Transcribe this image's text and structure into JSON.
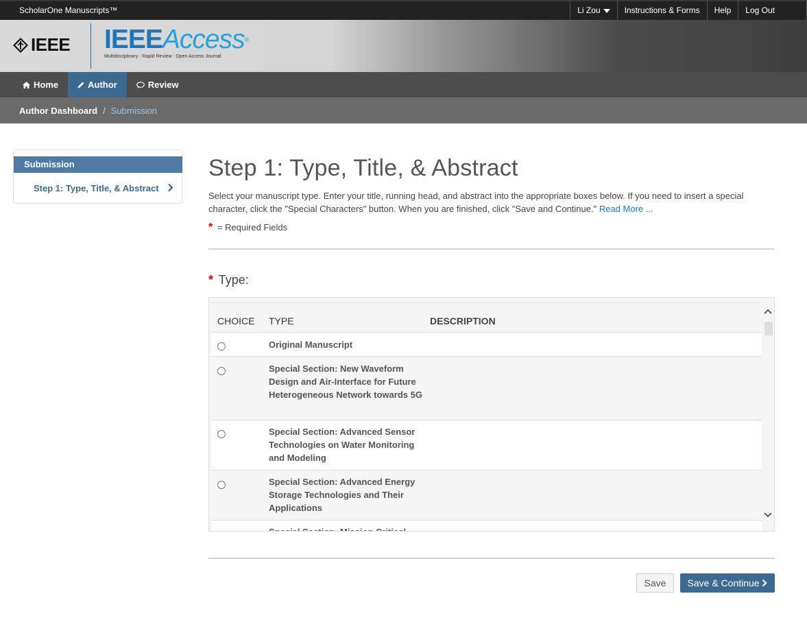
{
  "topbar": {
    "brand": "ScholarOne Manuscripts™",
    "user_menu": "Li Zou",
    "instructions": "Instructions & Forms",
    "help": "Help",
    "logout": "Log Out"
  },
  "header": {
    "ieee_logo_text": "IEEE",
    "access_logo_bold": "IEEE",
    "access_logo_thin": "Access",
    "access_tagline": [
      "Multidisciplinary",
      "Rapid Review",
      "Open Access Journal"
    ]
  },
  "mainnav": {
    "tabs": [
      {
        "label": "Home",
        "icon": "home-icon",
        "active": false
      },
      {
        "label": "Author",
        "icon": "pencil-icon",
        "active": true
      },
      {
        "label": "Review",
        "icon": "comment-icon",
        "active": false
      }
    ]
  },
  "breadcrumb": {
    "root": "Author Dashboard",
    "separator": "/",
    "current": "Submission"
  },
  "sidebar": {
    "heading": "Submission",
    "items": [
      {
        "label": "Step 1: Type, Title, & Abstract"
      }
    ]
  },
  "main": {
    "title": "Step 1: Type, Title, & Abstract",
    "intro": "Select your manuscript type. Enter your title, running head, and abstract into the appropriate boxes below. If you need to insert a special character, click the \"Special Characters\" button. When you are finished, click \"Save and Continue.\"",
    "read_more": "Read More ...",
    "required_marker": "*",
    "required_note": "= Required Fields",
    "type_label": "Type:",
    "table": {
      "columns": [
        "CHOICE",
        "TYPE",
        "DESCRIPTION"
      ],
      "rows": [
        {
          "type": "Original Manuscript",
          "description": ""
        },
        {
          "type": "Special Section: New Waveform Design and Air-Interface for Future Heterogeneous Network towards 5G",
          "description": ""
        },
        {
          "type": "Special Section: Advanced Sensor Technologies on Water Monitoring and Modeling",
          "description": ""
        },
        {
          "type": "Special Section: Advanced Energy Storage Technologies and Their Applications",
          "description": ""
        },
        {
          "type": "Special Section: Mission Critical",
          "description": ""
        }
      ]
    },
    "buttons": {
      "save": "Save",
      "save_continue": "Save & Continue"
    }
  },
  "colors": {
    "accent": "#3d6a91",
    "link": "#1f75b8",
    "required": "#dd0000"
  }
}
